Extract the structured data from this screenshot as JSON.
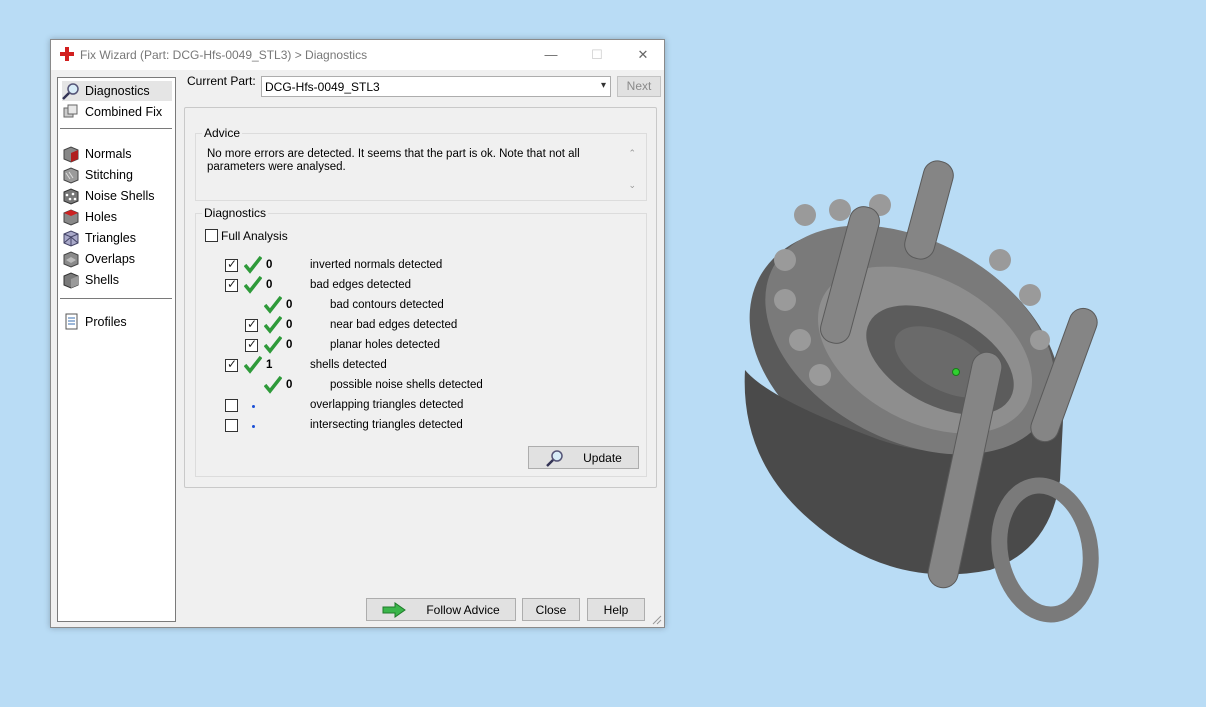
{
  "window": {
    "title": "Fix Wizard (Part: DCG-Hfs-0049_STL3) > Diagnostics",
    "minimize": "—",
    "maximize": "☐",
    "close": "✕"
  },
  "sidebar": {
    "items": [
      {
        "label": "Diagnostics",
        "icon": "magnifier-icon"
      },
      {
        "label": "Combined Fix",
        "icon": "combined-fix-icon"
      },
      {
        "label": "Normals",
        "icon": "normals-cube-icon"
      },
      {
        "label": "Stitching",
        "icon": "stitching-cube-icon"
      },
      {
        "label": "Noise Shells",
        "icon": "noise-shells-icon"
      },
      {
        "label": "Holes",
        "icon": "holes-cube-icon"
      },
      {
        "label": "Triangles",
        "icon": "triangles-cube-icon"
      },
      {
        "label": "Overlaps",
        "icon": "overlaps-cube-icon"
      },
      {
        "label": "Shells",
        "icon": "shells-cube-icon"
      },
      {
        "label": "Profiles",
        "icon": "profiles-document-icon"
      }
    ]
  },
  "header": {
    "current_part_label": "Current Part:",
    "current_part_value": "DCG-Hfs-0049_STL3",
    "next_label": "Next"
  },
  "advice": {
    "title": "Advice",
    "text": "No more errors are detected. It seems that the part is ok. Note that not all parameters were analysed."
  },
  "diagnostics": {
    "title": "Diagnostics",
    "full_analysis_label": "Full Analysis",
    "rows": [
      {
        "count": "0",
        "label": "inverted normals detected"
      },
      {
        "count": "0",
        "label": "bad edges detected"
      },
      {
        "count": "0",
        "label": "bad contours detected"
      },
      {
        "count": "0",
        "label": "near bad edges detected"
      },
      {
        "count": "0",
        "label": "planar holes detected"
      },
      {
        "count": "1",
        "label": "shells detected"
      },
      {
        "count": "0",
        "label": "possible noise shells detected"
      },
      {
        "count": "",
        "label": "overlapping triangles detected"
      },
      {
        "count": "",
        "label": "intersecting triangles detected"
      }
    ],
    "update_label": "Update"
  },
  "footer": {
    "follow_advice_label": "Follow Advice",
    "close_label": "Close",
    "help_label": "Help"
  },
  "colors": {
    "desktop": "#b9dcf5",
    "check_green": "#2e9a3a",
    "status_dot": "#1a4fd6",
    "model_gray": "#6e6e6e"
  }
}
